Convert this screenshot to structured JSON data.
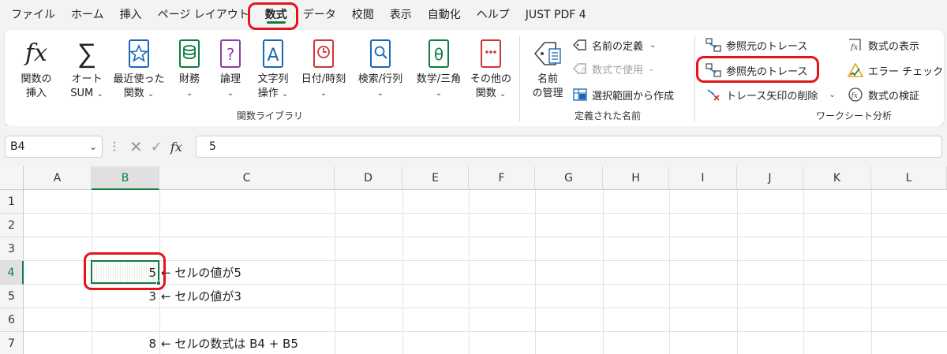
{
  "menu": {
    "tabs": [
      "ファイル",
      "ホーム",
      "挿入",
      "ページ レイアウト",
      "数式",
      "データ",
      "校閲",
      "表示",
      "自動化",
      "ヘルプ",
      "JUST PDF 4"
    ],
    "active_tab": "数式"
  },
  "ribbon": {
    "function_library": {
      "insert_fx": {
        "glyph": "fx",
        "line1": "関数の",
        "line2": "挿入"
      },
      "autosum": {
        "glyph": "∑",
        "line1": "オート",
        "line2": "SUM"
      },
      "recent": {
        "line1": "最近使った",
        "line2": "関数"
      },
      "financial": {
        "line1": "財務"
      },
      "logical": {
        "glyph": "?",
        "line1": "論理"
      },
      "text": {
        "glyph": "A",
        "line1": "文字列",
        "line2": "操作"
      },
      "datetime": {
        "line1": "日付/時刻"
      },
      "lookup": {
        "line1": "検索/行列"
      },
      "math": {
        "glyph": "θ",
        "line1": "数学/三角"
      },
      "more": {
        "line1": "その他の",
        "line2": "関数"
      },
      "group_label": "関数ライブラリ"
    },
    "defined_names": {
      "name_manager": {
        "line1": "名前",
        "line2": "の管理"
      },
      "define_name": "名前の定義",
      "use_in_formula": "数式で使用",
      "create_from_selection": "選択範囲から作成",
      "group_label": "定義された名前"
    },
    "formula_auditing": {
      "trace_precedents": "参照元のトレース",
      "trace_dependents": "参照先のトレース",
      "remove_arrows": "トレース矢印の削除",
      "show_formulas": "数式の表示",
      "error_checking": "エラー チェック",
      "evaluate_formula": "数式の検証",
      "group_label": "ワークシート分析"
    }
  },
  "formula_bar": {
    "name_box": "B4",
    "fx_label": "fx",
    "value": "5"
  },
  "grid": {
    "columns": [
      "A",
      "B",
      "C",
      "D",
      "E",
      "F",
      "G",
      "H",
      "I",
      "J",
      "K",
      "L"
    ],
    "rows": [
      "1",
      "2",
      "3",
      "4",
      "5",
      "6",
      "7"
    ],
    "selected_column": "B",
    "selected_row": "4",
    "cells": {
      "B4": "5",
      "B5": "3",
      "B7": "8"
    },
    "notes": {
      "row4": "← セルの値が5",
      "row5": "← セルの値が3",
      "row7": "← セルの数式は B4 + B5"
    }
  },
  "colors": {
    "excel_green": "#107c41",
    "highlight_red": "#e3151a"
  }
}
